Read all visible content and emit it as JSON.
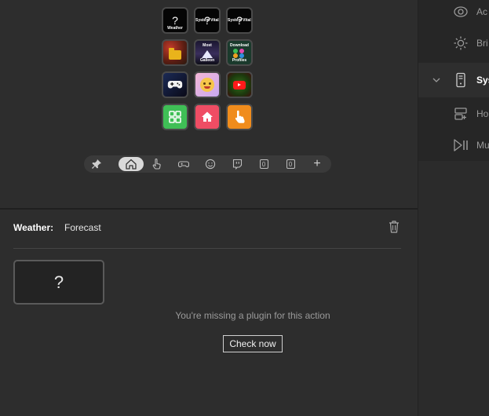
{
  "keys": [
    {
      "name": "key-weather",
      "top_caption": "",
      "bottom_caption": "Weather",
      "glyph": "?"
    },
    {
      "name": "key-system-vitals-1",
      "top_caption": "System Vitals",
      "bottom_caption": "",
      "glyph": "?"
    },
    {
      "name": "key-system-vitals-2",
      "top_caption": "System Vitals",
      "bottom_caption": "",
      "glyph": "?"
    },
    {
      "name": "key-folder",
      "top_caption": "",
      "bottom_caption": "",
      "glyph": ""
    },
    {
      "name": "key-most-galleon",
      "top_caption": "Most",
      "bottom_caption": "Galleon",
      "glyph": ""
    },
    {
      "name": "key-download-profiles",
      "top_caption": "Download",
      "bottom_caption": "Profiles",
      "glyph": ""
    },
    {
      "name": "key-gaming",
      "top_caption": "",
      "bottom_caption": "",
      "glyph": ""
    },
    {
      "name": "key-emoji",
      "top_caption": "",
      "bottom_caption": "",
      "glyph": ""
    },
    {
      "name": "key-youtube",
      "top_caption": "",
      "bottom_caption": "",
      "glyph": ""
    },
    {
      "name": "key-apps",
      "top_caption": "",
      "bottom_caption": "",
      "glyph": ""
    },
    {
      "name": "key-home",
      "top_caption": "",
      "bottom_caption": "",
      "glyph": ""
    },
    {
      "name": "key-touch",
      "top_caption": "",
      "bottom_caption": "",
      "glyph": ""
    }
  ],
  "pagebar": {
    "icons": [
      "pin-icon",
      "home-icon",
      "hand-pointer-icon",
      "gamepad-icon",
      "smiley-icon",
      "twitch-icon",
      "page-0-icon",
      "page-0-icon",
      "plus-icon"
    ],
    "page_labels": [
      "0",
      "0"
    ],
    "add_label": "+"
  },
  "action": {
    "title": "Weather:",
    "subtitle": "Forecast",
    "preview_glyph": "?",
    "missing_text": "You're missing a plugin for this action",
    "check_button": "Check now"
  },
  "sidebar": {
    "items": [
      {
        "label": "Ac",
        "icon": "activity-icon"
      },
      {
        "label": "Bri",
        "icon": "brightness-icon"
      },
      {
        "label": "Sys",
        "icon": "computer-tower-icon"
      },
      {
        "label": "Ho",
        "icon": "hotkey-icon"
      },
      {
        "label": "Mu",
        "icon": "media-play-pause-icon"
      }
    ]
  },
  "colors": {
    "accent_green": "#3fbf56",
    "accent_pink": "#ef4d64",
    "accent_orange": "#f08c1c",
    "bg": "#2d2d2d"
  }
}
